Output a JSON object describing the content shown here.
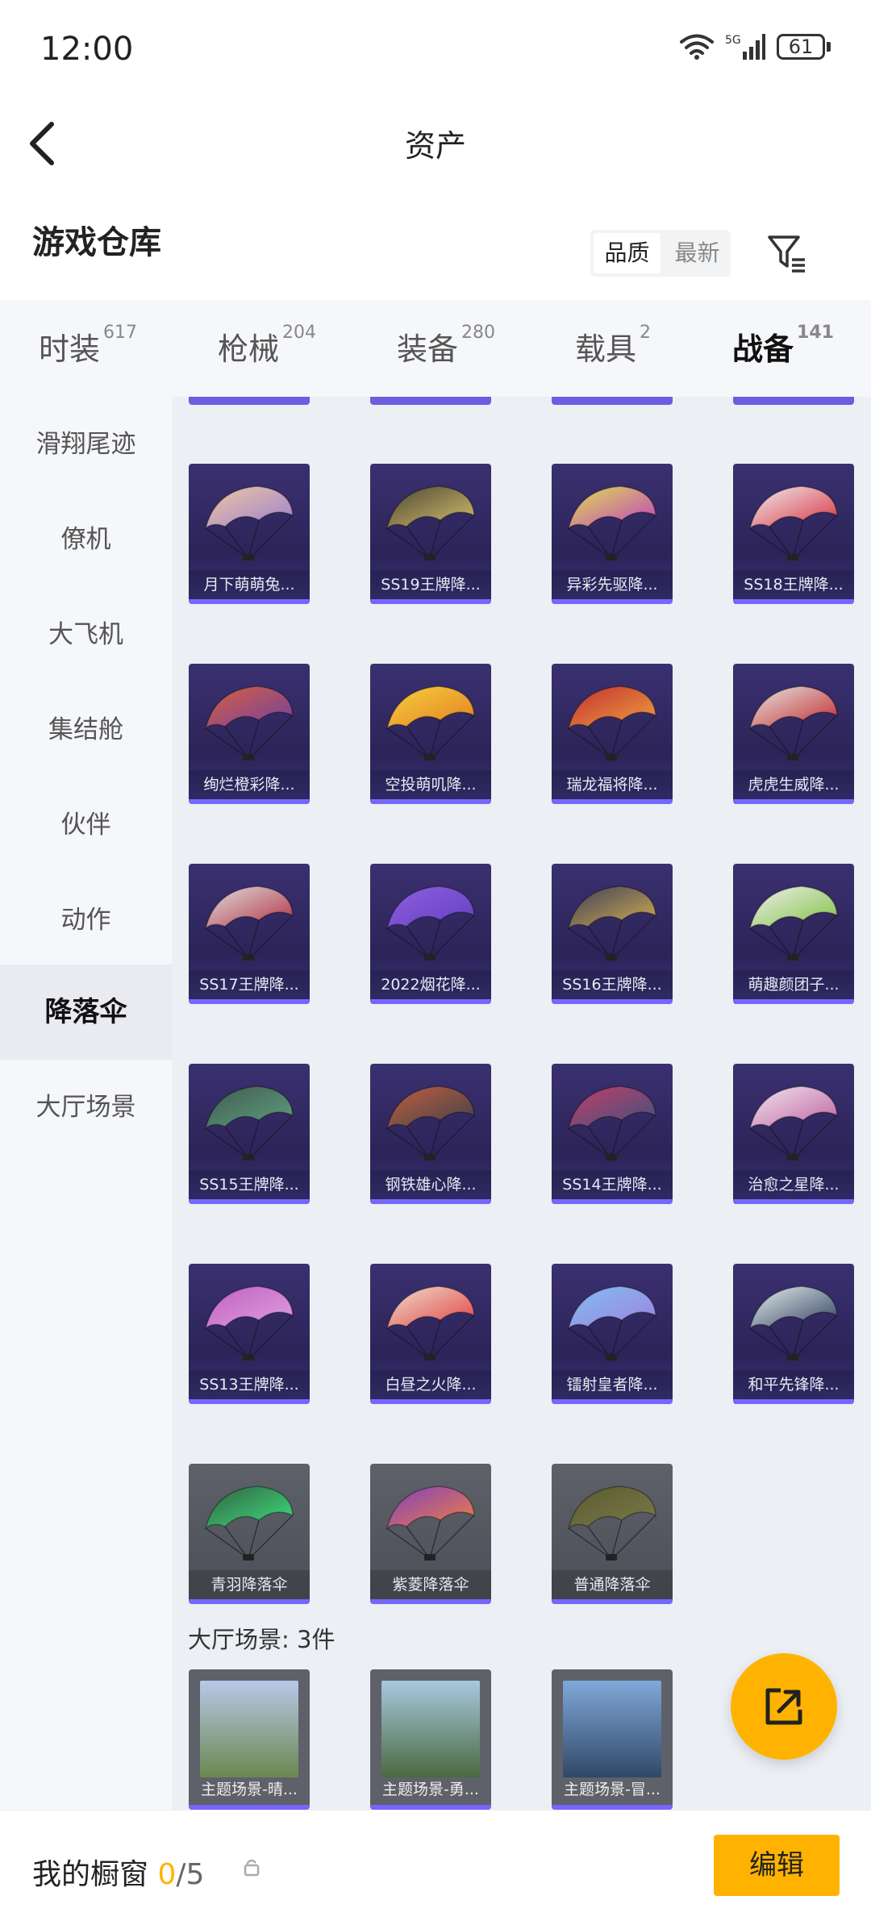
{
  "status": {
    "time": "12:00",
    "network": "5G",
    "battery": "61"
  },
  "header": {
    "title": "资产"
  },
  "warehouse": {
    "title": "游戏仓库",
    "sort_options": [
      "品质",
      "最新"
    ],
    "sort_selected": "品质"
  },
  "tabs": [
    {
      "label": "时装",
      "count": "617"
    },
    {
      "label": "枪械",
      "count": "204"
    },
    {
      "label": "装备",
      "count": "280"
    },
    {
      "label": "载具",
      "count": "2"
    },
    {
      "label": "战备",
      "count": "141",
      "active": true
    }
  ],
  "sidebar": [
    {
      "label": "滑翔尾迹"
    },
    {
      "label": "僚机"
    },
    {
      "label": "大飞机"
    },
    {
      "label": "集结舱"
    },
    {
      "label": "伙伴"
    },
    {
      "label": "动作"
    },
    {
      "label": "降落伞",
      "active": true
    },
    {
      "label": "大厅场景"
    }
  ],
  "parachutes": [
    {
      "name": "月下萌萌兔...",
      "colors": [
        "#f0c9a0",
        "#9a7fd0"
      ]
    },
    {
      "name": "SS19王牌降...",
      "colors": [
        "#4a4632",
        "#d8c070"
      ]
    },
    {
      "name": "异彩先驱降...",
      "colors": [
        "#e0e050",
        "#c040c0"
      ]
    },
    {
      "name": "SS18王牌降...",
      "colors": [
        "#f0f0f0",
        "#d83040"
      ]
    },
    {
      "name": "绚烂橙彩降...",
      "colors": [
        "#d86040",
        "#7040a0"
      ]
    },
    {
      "name": "空投萌叽降...",
      "colors": [
        "#f8d040",
        "#e08020"
      ]
    },
    {
      "name": "瑞龙福将降...",
      "colors": [
        "#c03030",
        "#f0a040"
      ]
    },
    {
      "name": "虎虎生威降...",
      "colors": [
        "#e8e8e8",
        "#c02828"
      ]
    },
    {
      "name": "SS17王牌降...",
      "colors": [
        "#e0e0e0",
        "#b03040"
      ]
    },
    {
      "name": "2022烟花降...",
      "colors": [
        "#9060e0",
        "#6040c0"
      ]
    },
    {
      "name": "SS16王牌降...",
      "colors": [
        "#403c5a",
        "#d0b050"
      ]
    },
    {
      "name": "萌趣颜团子...",
      "colors": [
        "#f0f0f0",
        "#80c040"
      ]
    },
    {
      "name": "SS15王牌降...",
      "colors": [
        "#405a50",
        "#60a080"
      ]
    },
    {
      "name": "钢铁雄心降...",
      "colors": [
        "#c06040",
        "#404048"
      ]
    },
    {
      "name": "SS14王牌降...",
      "colors": [
        "#c04068",
        "#405080"
      ]
    },
    {
      "name": "治愈之星降...",
      "colors": [
        "#f0e8f0",
        "#c060a0"
      ]
    },
    {
      "name": "SS13王牌降...",
      "colors": [
        "#c060c0",
        "#e0a0e0"
      ]
    },
    {
      "name": "白昼之火降...",
      "colors": [
        "#f0e0d0",
        "#e04040"
      ]
    },
    {
      "name": "镭射皇者降...",
      "colors": [
        "#80c0f0",
        "#a080e0"
      ]
    },
    {
      "name": "和平先锋降...",
      "colors": [
        "#e8f0f0",
        "#304060"
      ]
    },
    {
      "name": "青羽降落伞",
      "colors": [
        "#306040",
        "#40e080"
      ],
      "gray": true
    },
    {
      "name": "紫菱降落伞",
      "colors": [
        "#8040c0",
        "#f08040"
      ],
      "gray": true
    },
    {
      "name": "普通降落伞",
      "colors": [
        "#5a5a32",
        "#7a7a48"
      ],
      "gray": true
    }
  ],
  "lobby": {
    "header": "大厅场景: 3件",
    "items": [
      {
        "name": "主题场景-晴...",
        "colors": [
          "#b8c8e8",
          "#6a8850"
        ]
      },
      {
        "name": "主题场景-勇...",
        "colors": [
          "#a8c8e0",
          "#4a6a40"
        ]
      },
      {
        "name": "主题场景-冒...",
        "colors": [
          "#80a8d8",
          "#304868"
        ]
      }
    ]
  },
  "bottom": {
    "showcase_label": "我的橱窗",
    "showcase_count": "0",
    "showcase_max": "/5",
    "edit_label": "编辑"
  },
  "accent": "#ffb300"
}
